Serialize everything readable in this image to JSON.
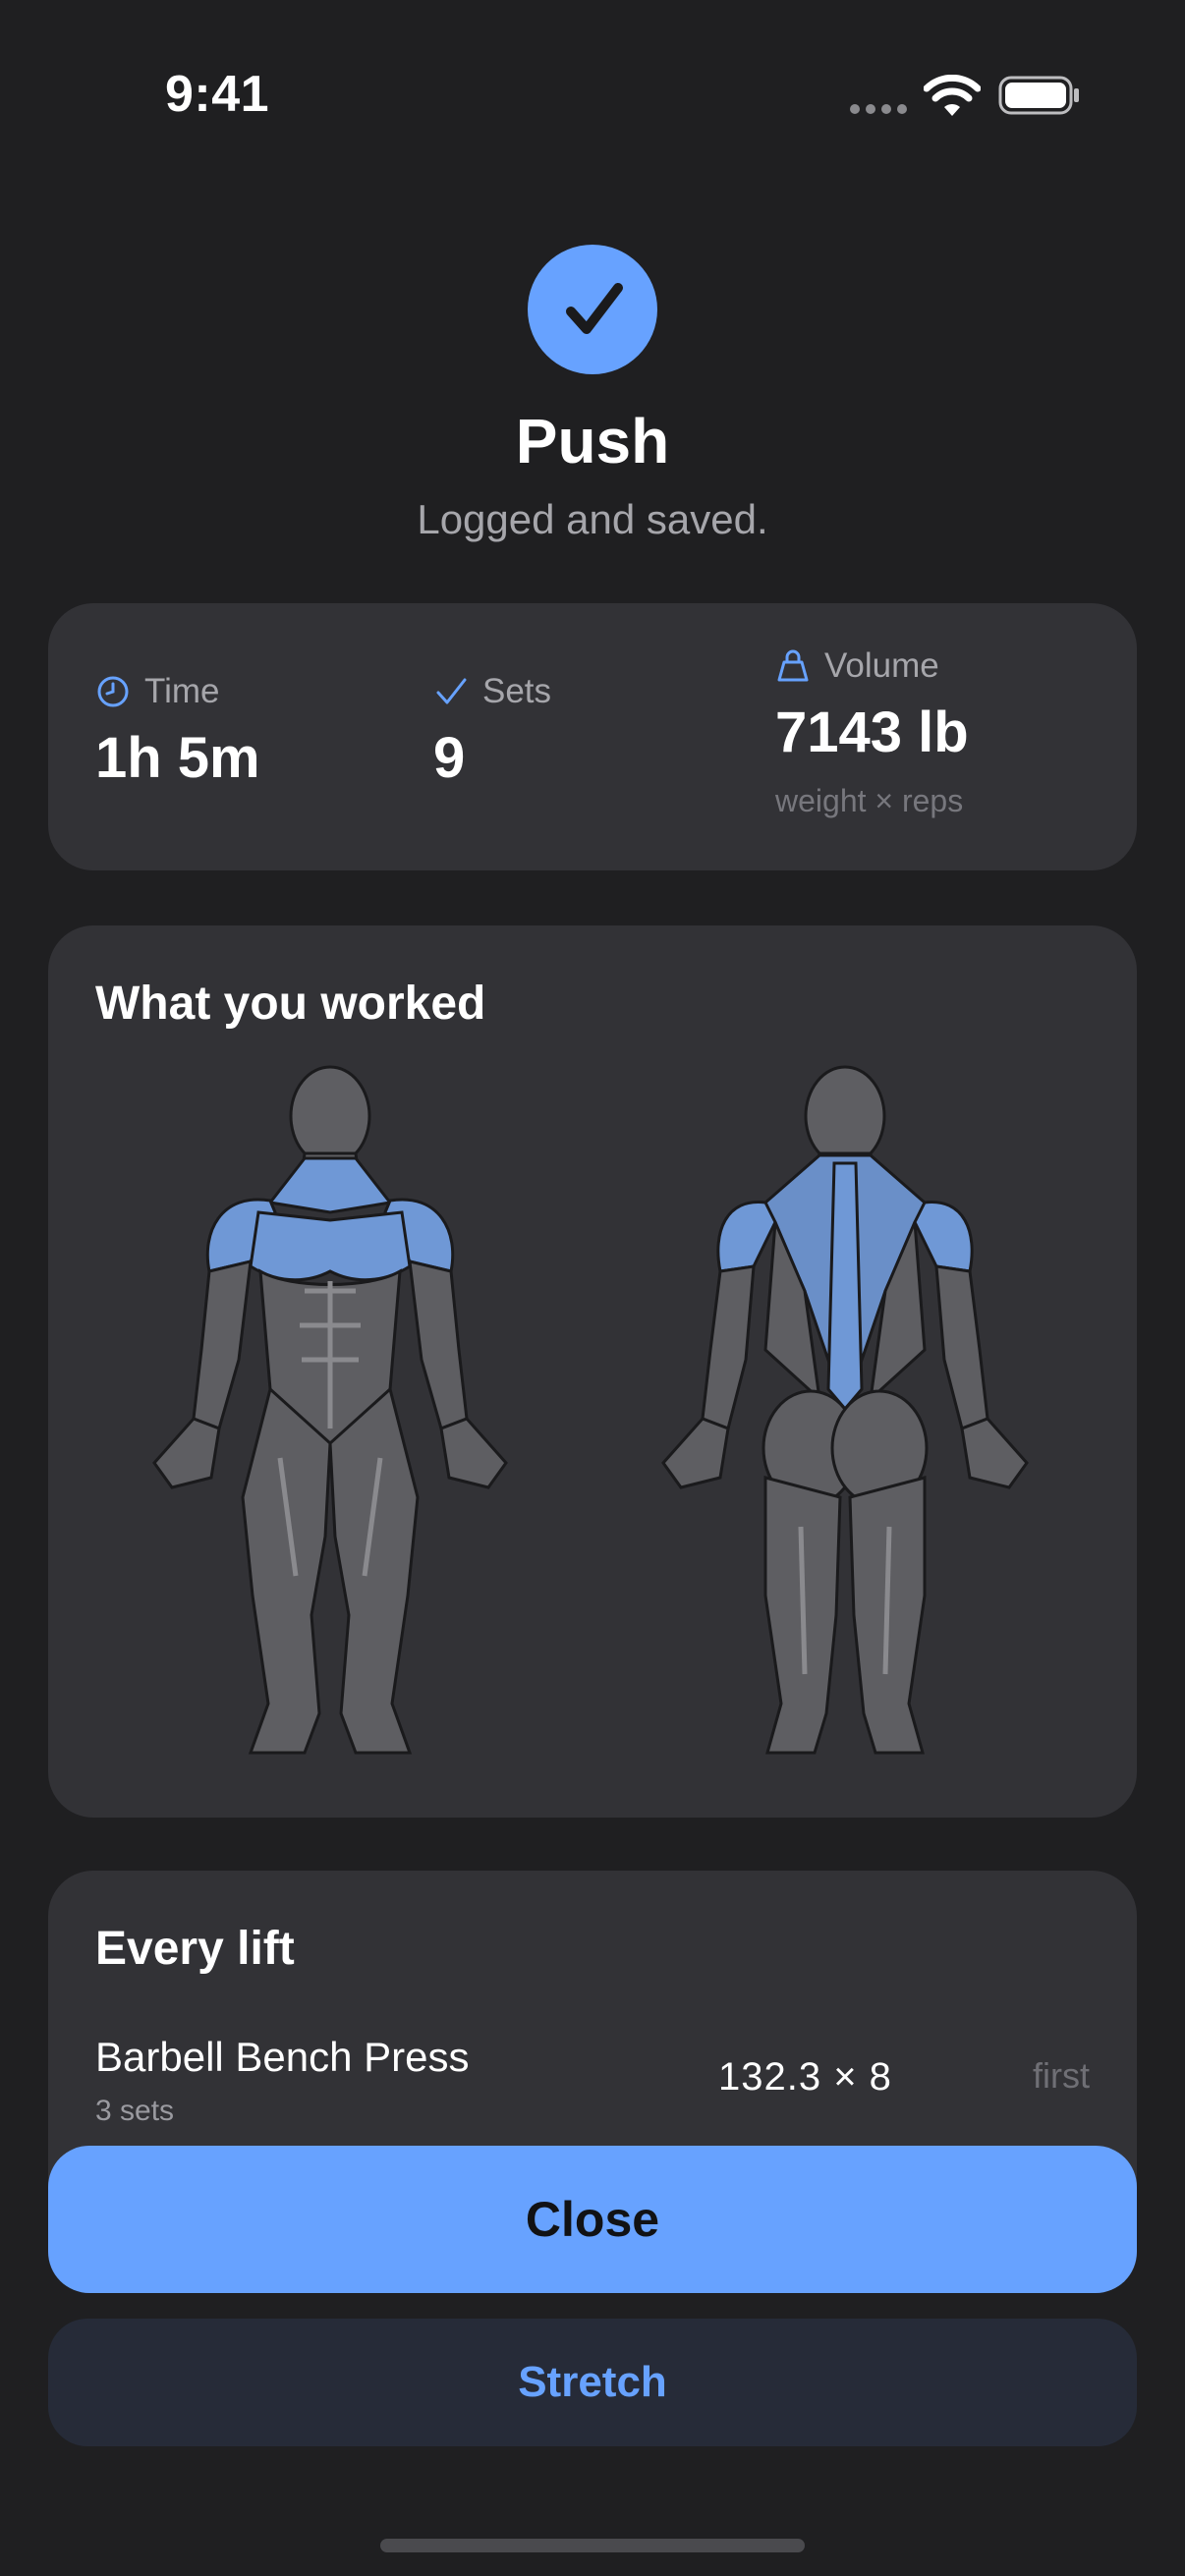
{
  "status_bar": {
    "time": "9:41"
  },
  "header": {
    "title": "Push",
    "subtitle": "Logged and saved."
  },
  "stats": {
    "time": {
      "label": "Time",
      "value": "1h 5m",
      "icon": "clock-icon"
    },
    "sets": {
      "label": "Sets",
      "value": "9",
      "icon": "checkmark-icon"
    },
    "volume": {
      "label": "Volume",
      "value": "7143 lb",
      "note": "weight × reps",
      "icon": "kettlebell-icon"
    }
  },
  "muscles": {
    "title": "What you worked",
    "worked": [
      "shoulders",
      "chest",
      "traps",
      "upper-back",
      "rear-delts"
    ]
  },
  "lifts": {
    "title": "Every lift",
    "items": [
      {
        "name": "Barbell Bench Press",
        "sets": "3 sets",
        "best": "132.3 × 8",
        "tag": "first"
      }
    ]
  },
  "actions": {
    "close_label": "Close",
    "stretch_label": "Stretch"
  },
  "colors": {
    "accent": "#67a2ff",
    "background": "#1f1f21",
    "card": "#323236",
    "muscle_base": "#5e5e62",
    "muscle_highlight": "#6f98d6"
  }
}
